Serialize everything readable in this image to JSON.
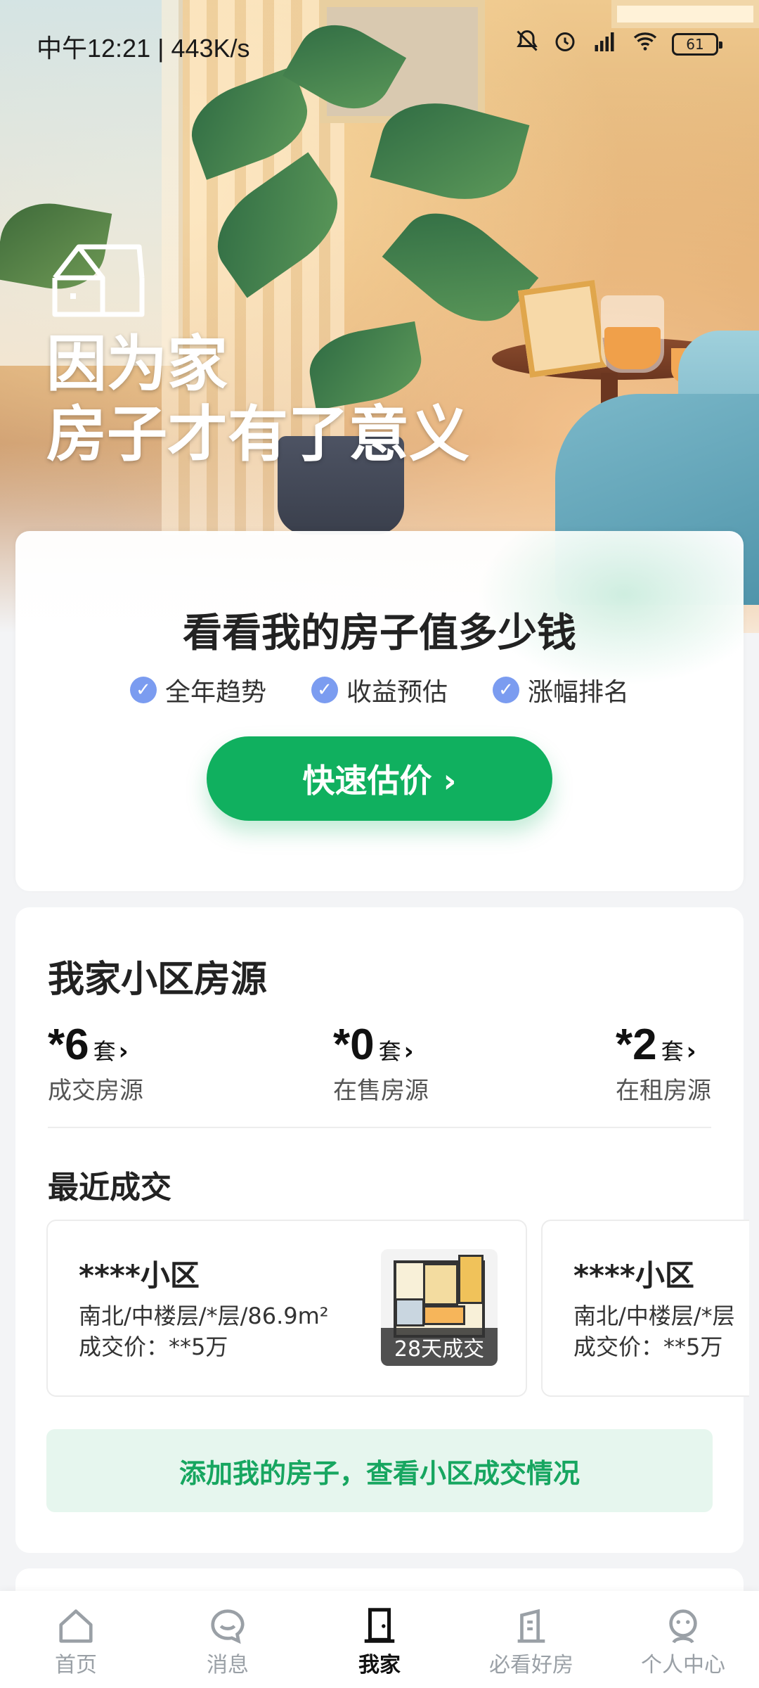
{
  "status_bar": {
    "time": "中午12:21 | 443K/s",
    "battery": "61"
  },
  "hero": {
    "slogan_line1": "因为家",
    "slogan_line2": "房子才有了意义"
  },
  "valuation": {
    "title": "看看我的房子值多少钱",
    "features": [
      "全年趋势",
      "收益预估",
      "涨幅排名"
    ],
    "button_label": "快速估价 ›"
  },
  "community": {
    "title": "我家小区房源",
    "stats": [
      {
        "value": "*6",
        "unit": "套",
        "label": "成交房源"
      },
      {
        "value": "*0",
        "unit": "套",
        "label": "在售房源"
      },
      {
        "value": "*2",
        "unit": "套",
        "label": "在租房源"
      }
    ],
    "recent_title": "最近成交",
    "deals": [
      {
        "name": "****小区",
        "info": "南北/中楼层/*层/86.9m²",
        "price": "成交价：**5万",
        "tag": "28天成交"
      },
      {
        "name": "****小区",
        "info": "南北/中楼层/*层",
        "price": "成交价：**5万"
      }
    ],
    "add_label": "添加我的房子，查看小区成交情况"
  },
  "tabbar": {
    "items": [
      {
        "label": "首页",
        "icon": "home-icon"
      },
      {
        "label": "消息",
        "icon": "message-icon"
      },
      {
        "label": "我家",
        "icon": "door-icon",
        "active": true
      },
      {
        "label": "必看好房",
        "icon": "building-icon"
      },
      {
        "label": "个人中心",
        "icon": "user-icon"
      }
    ]
  }
}
